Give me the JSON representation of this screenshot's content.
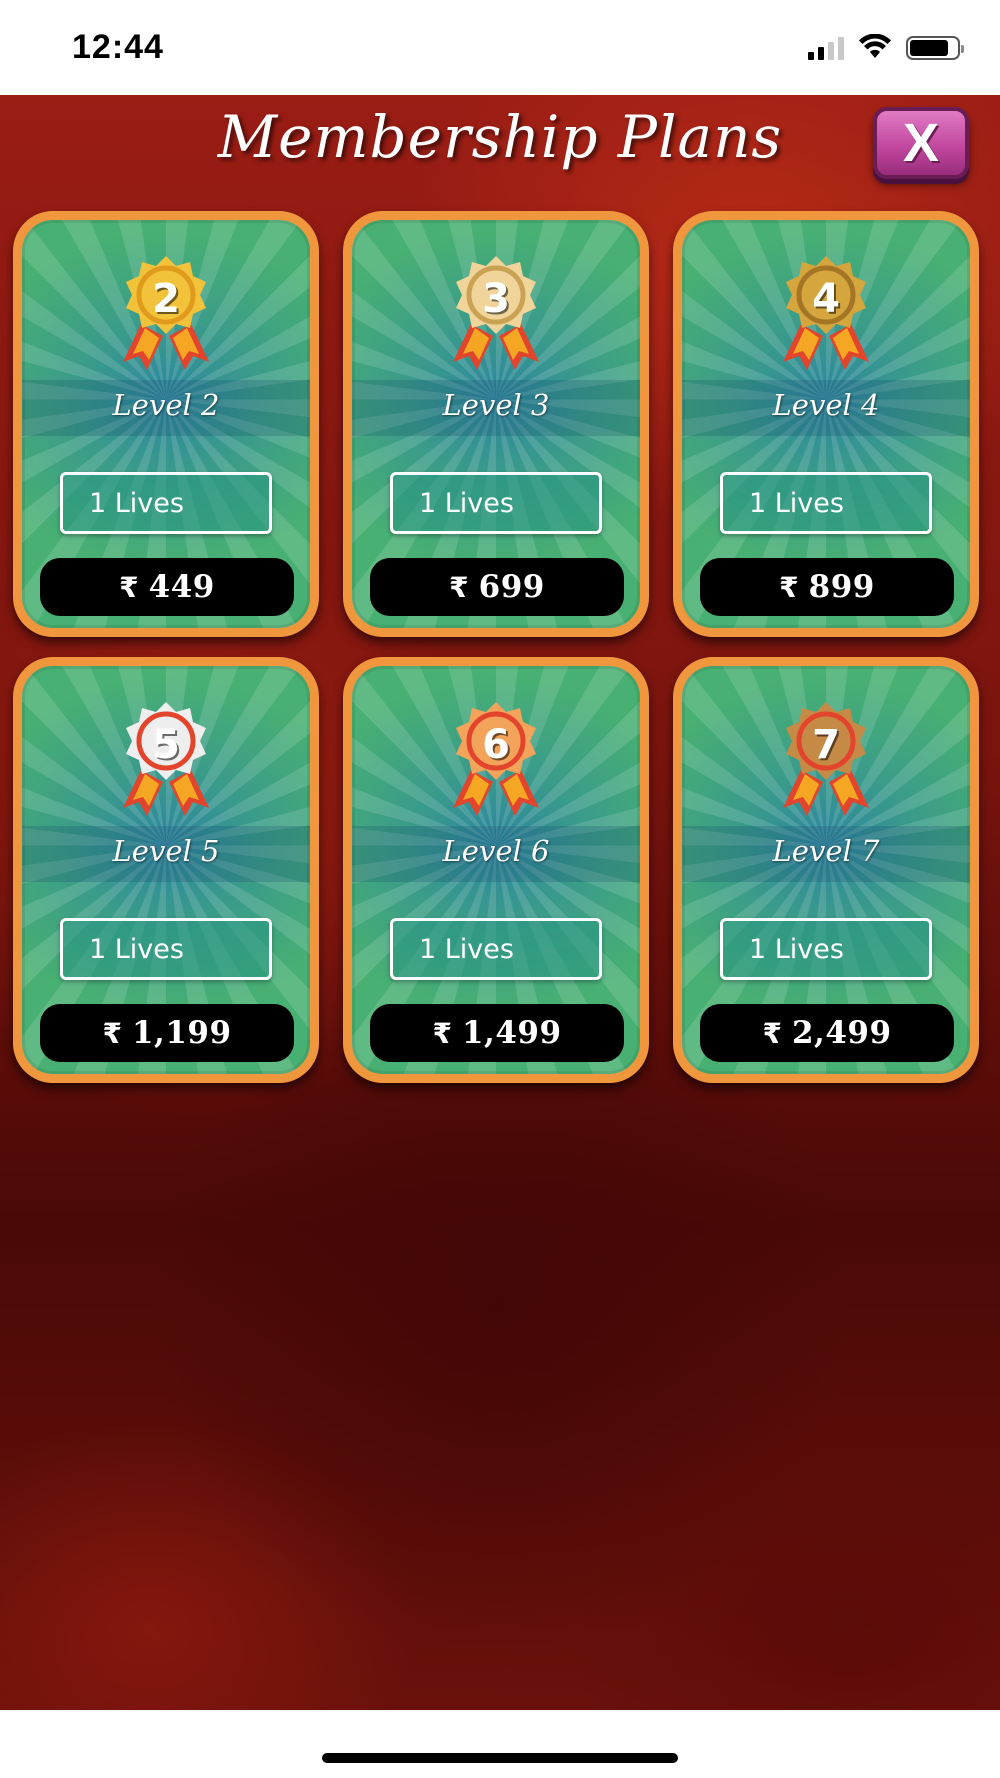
{
  "status_bar": {
    "time": "12:44"
  },
  "header": {
    "title": "Membership Plans",
    "close_label": "X"
  },
  "colors": {
    "card_border": "#f0963c",
    "close_button": "#c2489f",
    "background": "#7a140e"
  },
  "plans": [
    {
      "badge_number": "2",
      "level": "Level 2",
      "lives": "1 Lives",
      "currency": "₹",
      "price": "449",
      "badge_color": "#f2c23a",
      "badge_ring": "#e09a1c"
    },
    {
      "badge_number": "3",
      "level": "Level 3",
      "lives": "1 Lives",
      "currency": "₹",
      "price": "699",
      "badge_color": "#f0d49a",
      "badge_ring": "#c9a254"
    },
    {
      "badge_number": "4",
      "level": "Level 4",
      "lives": "1 Lives",
      "currency": "₹",
      "price": "899",
      "badge_color": "#d6a63e",
      "badge_ring": "#a47524"
    },
    {
      "badge_number": "5",
      "level": "Level 5",
      "lives": "1 Lives",
      "currency": "₹",
      "price": "1,199",
      "badge_color": "#eeeeee",
      "badge_ring": "#e2452c"
    },
    {
      "badge_number": "6",
      "level": "Level 6",
      "lives": "1 Lives",
      "currency": "₹",
      "price": "1,499",
      "badge_color": "#f3a35a",
      "badge_ring": "#e2452c"
    },
    {
      "badge_number": "7",
      "level": "Level 7",
      "lives": "1 Lives",
      "currency": "₹",
      "price": "2,499",
      "badge_color": "#c58a45",
      "badge_ring": "#e2452c"
    }
  ]
}
